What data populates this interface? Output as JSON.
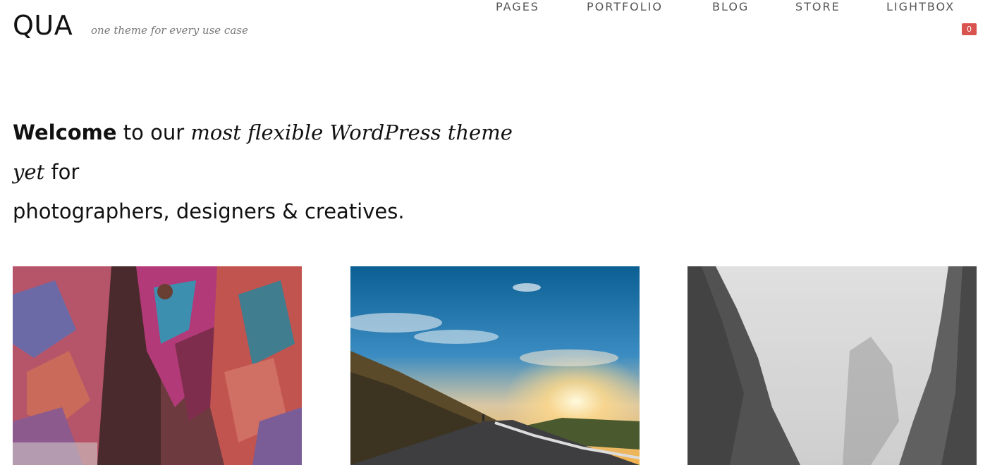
{
  "site": {
    "logo": "QUA",
    "tagline": "one theme for every use case"
  },
  "nav": {
    "items": [
      {
        "label": "PAGES"
      },
      {
        "label": "PORTFOLIO"
      },
      {
        "label": "BLOG"
      },
      {
        "label": "STORE"
      },
      {
        "label": "LIGHTBOX"
      }
    ],
    "lightbox_count": "0"
  },
  "hero": {
    "bold": "Welcome",
    "text1": " to our ",
    "italic": "most flexible WordPress theme yet",
    "text2": " for",
    "line2": "photographers, designers & creatives."
  },
  "gallery": {
    "items": [
      {
        "subject": "patterned poncho"
      },
      {
        "subject": "mountain road at sunset"
      },
      {
        "subject": "misty cliffs"
      }
    ]
  },
  "colors": {
    "badge": "#d9534f",
    "nav_text": "#555555",
    "tagline": "#777777"
  }
}
